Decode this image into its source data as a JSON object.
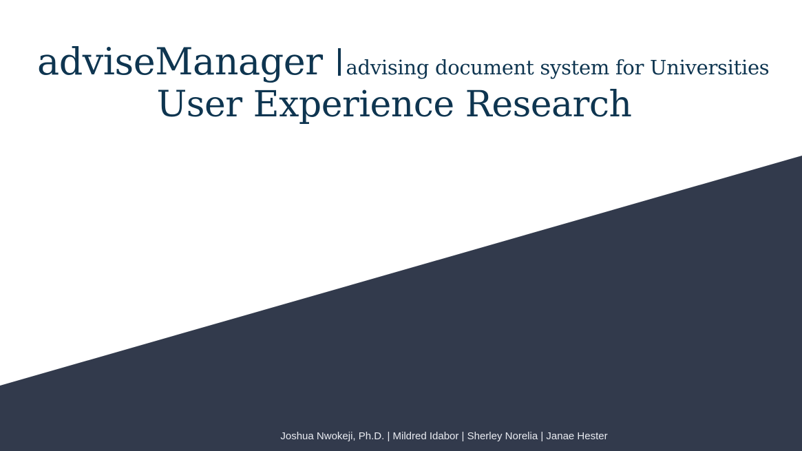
{
  "slide": {
    "app_name": "adviseManager",
    "separator": "|",
    "tagline": "advising document system for Universities",
    "subtitle": "User Experience Research",
    "authors": "Joshua Nwokeji, Ph.D. | Mildred Idabor | Sherley Norelia | Janae Hester"
  },
  "colors": {
    "title": "#0e3550",
    "band": "#323a4c",
    "background": "#ffffff",
    "authors_text": "#e8eaf0"
  }
}
